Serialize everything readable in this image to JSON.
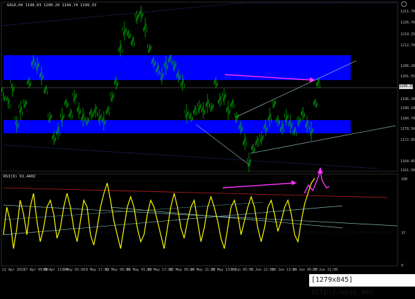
{
  "header": {
    "symbol_info": "GOLD,H4  1198.03 1200.20 1194.74 1199.33",
    "rsi_info": "RSI(9) 91.4402"
  },
  "price_axis": {
    "labels": [
      "1211.70",
      "1226.70",
      "1219.25",
      "1212.70",
      "1206.20",
      "1201.55",
      "1196.20",
      "1189.10",
      "1184.70",
      "1178.50",
      "1172.95",
      "1164.85",
      "1161.50"
    ],
    "current_price": "1199.33"
  },
  "rsi_axis": {
    "labels": [
      "100",
      "37",
      "0"
    ],
    "current_value": ""
  },
  "time_axis": {
    "labels": [
      "22 Apr 2015",
      "27 Apr 09:00",
      "30 Apr 13:00",
      "5 May 01:00",
      "8 May 17:00",
      "12 May 09:00",
      "15 May 01:00",
      "19 May 17:00",
      "22 May 09:00",
      "26 May 21:00",
      "29 May 13:00",
      "3 Jun 05:00",
      "5 Jun 21:00",
      "10 Jun 13:00",
      "15 Jun 05:00",
      "17 Jun 21:00"
    ]
  },
  "watermark": {
    "text": "[1279x845] http://upic.me/"
  },
  "colors": {
    "background": "#000000",
    "candles": "#00c800",
    "zones": "#0000ff",
    "rsi_line": "#ffff00",
    "arrows": "#ff33ff",
    "trend_lines": "#8fb3b3",
    "channel_dots": "#2b3a8a"
  }
}
